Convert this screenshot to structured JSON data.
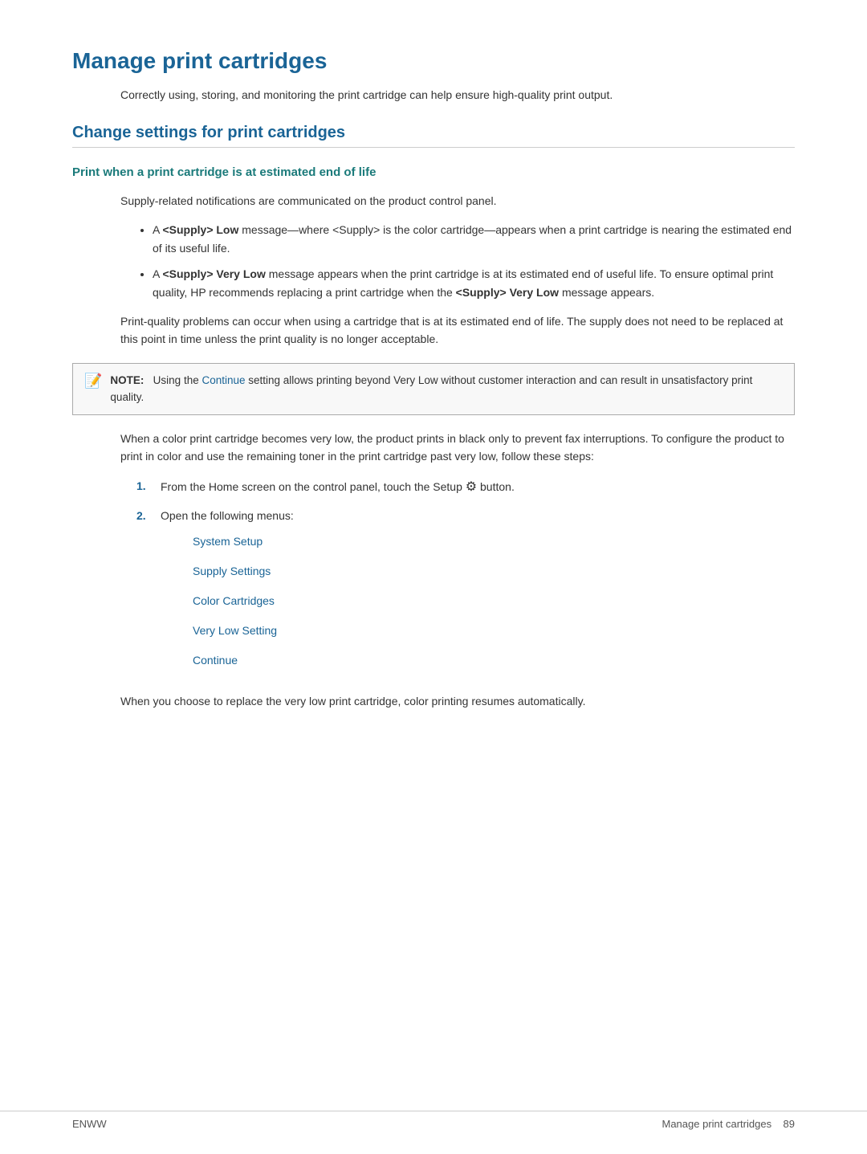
{
  "page": {
    "title": "Manage print cartridges",
    "intro": "Correctly using, storing, and monitoring the print cartridge can help ensure high-quality print output.",
    "section1": {
      "heading": "Change settings for print cartridges",
      "subsection1": {
        "heading": "Print when a print cartridge is at estimated end of life",
        "body1": "Supply-related notifications are communicated on the product control panel.",
        "bullets": [
          "A <Supply> Low message—where <Supply> is the color cartridge—appears when a print cartridge is nearing the estimated end of its useful life.",
          "A <Supply> Very Low message appears when the print cartridge is at its estimated end of useful life. To ensure optimal print quality, HP recommends replacing a print cartridge when the <Supply> Very Low message appears."
        ],
        "bullet1_bold_start": "Supply> Low",
        "bullet2_bold_start": "Supply> Very Low",
        "bullet2_bold_end": "<Supply> Very Low",
        "body2": "Print-quality problems can occur when using a cartridge that is at its estimated end of life. The supply does not need to be replaced at this point in time unless the print quality is no longer acceptable.",
        "note": {
          "label": "NOTE:",
          "text": "Using the Continue setting allows printing beyond Very Low without customer interaction and can result in unsatisfactory print quality.",
          "link_word": "Continue"
        },
        "body3": "When a color print cartridge becomes very low, the product prints in black only to prevent fax interruptions. To configure the product to print in color and use the remaining toner in the print cartridge past very low, follow these steps:",
        "steps": [
          {
            "num": "1.",
            "text": "From the Home screen on the control panel, touch the Setup",
            "has_icon": true,
            "icon": "⚙",
            "text_after": "button."
          },
          {
            "num": "2.",
            "text": "Open the following menus:",
            "has_icon": false
          }
        ],
        "menu_items": [
          "System Setup",
          "Supply Settings",
          "Color Cartridges",
          "Very Low Setting",
          "Continue"
        ],
        "body4": "When you choose to replace the very low print cartridge, color printing resumes automatically."
      }
    }
  },
  "footer": {
    "left": "ENWW",
    "right_label": "Manage print cartridges",
    "page_num": "89"
  }
}
